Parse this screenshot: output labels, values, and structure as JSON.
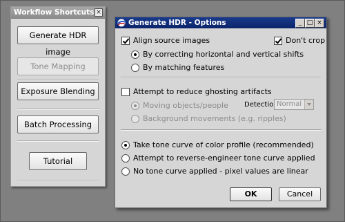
{
  "workflow": {
    "title": "Workflow Shortcuts",
    "close_glyph": "×",
    "buttons": {
      "generate_hdr": "Generate HDR image",
      "tone_mapping": "Tone Mapping",
      "exposure_blending": "Exposure Blending",
      "batch_processing": "Batch Processing",
      "tutorial": "Tutorial"
    },
    "tone_mapping_enabled": false
  },
  "dialog": {
    "title": "Generate HDR - Options",
    "title_bar_color": "#0a246a",
    "window_buttons": {
      "minimize": "_",
      "maximize": "□",
      "close": "×"
    },
    "align": {
      "label": "Align source images",
      "checked": true,
      "options": [
        {
          "label": "By correcting horizontal and vertical shifts",
          "selected": true
        },
        {
          "label": "By matching features",
          "selected": false
        }
      ]
    },
    "dont_crop": {
      "label": "Don't crop",
      "checked": true
    },
    "ghosting": {
      "label": "Attempt to reduce ghosting artifacts",
      "checked": false,
      "options": [
        {
          "label": "Moving objects/people",
          "selected": true
        },
        {
          "label": "Background movements (e.g. ripples)",
          "selected": false
        }
      ],
      "detection_label": "Detection:",
      "detection_value": "Normal"
    },
    "tone_curve": {
      "options": [
        {
          "label": "Take tone curve of color profile (recommended)",
          "selected": true
        },
        {
          "label": "Attempt to reverse-engineer tone curve applied",
          "selected": false
        },
        {
          "label": "No tone curve applied - pixel values are linear",
          "selected": false
        }
      ]
    },
    "buttons": {
      "ok": "OK",
      "cancel": "Cancel"
    }
  }
}
